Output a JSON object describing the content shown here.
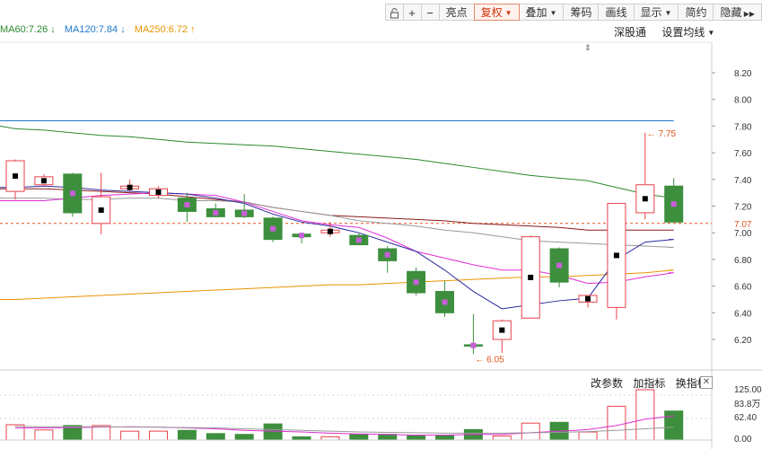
{
  "toolbar": {
    "lock_icon": "lock-icon",
    "zoom_in_icon": "plus-icon",
    "zoom_out_icon": "minus-icon",
    "highlight_label": "亮点",
    "restore_rights_label": "复权",
    "overlay_label": "叠加",
    "chips_label": "筹码",
    "draw_label": "画线",
    "display_label": "显示",
    "brief_label": "简约",
    "hide_label": "隐藏",
    "more_icon": "double-chevron-right-icon"
  },
  "legend": {
    "ma60": "MA60:7.26",
    "ma120": "MA120:7.84",
    "ma250": "MA250:6.72",
    "ma60_arrow": "↓",
    "ma120_arrow": "↓",
    "ma250_arrow": "↑",
    "colors": {
      "ma60": "#2c8a2c",
      "ma120": "#1f77c9",
      "ma250": "#e89400"
    }
  },
  "top_right": {
    "connect_label": "深股通",
    "settings_label": "设置均线"
  },
  "price_axis": {
    "ticks": [
      "8.20",
      "8.00",
      "7.80",
      "7.60",
      "7.40",
      "7.20",
      "7.00",
      "6.80",
      "6.60",
      "6.40",
      "6.20"
    ],
    "current_price": "7.07",
    "current_color": "#e3531b"
  },
  "annotations": {
    "high_label": "7.75",
    "low_label": "6.05",
    "label_color": "#e3531b"
  },
  "volume_panel": {
    "change_params_label": "改参数",
    "add_indicator_label": "加指标",
    "switch_indicator_label": "换指标",
    "close_icon": "close-icon",
    "axis_ticks": [
      "125.00",
      "62.40",
      "0.00"
    ],
    "max_label": "83.8万"
  },
  "chart_data": {
    "type": "candlestick",
    "ylim": [
      6.05,
      8.28
    ],
    "colors": {
      "up": "#e8414b",
      "down": "#3d8f3d"
    },
    "candles": [
      {
        "o": 7.31,
        "c": 7.54,
        "h": 7.55,
        "l": 7.25,
        "vol": 38
      },
      {
        "o": 7.36,
        "c": 7.42,
        "h": 7.44,
        "l": 7.35,
        "vol": 25
      },
      {
        "o": 7.44,
        "c": 7.15,
        "h": 7.45,
        "l": 7.12,
        "vol": 36
      },
      {
        "o": 7.07,
        "c": 7.27,
        "h": 7.45,
        "l": 6.99,
        "vol": 36
      },
      {
        "o": 7.33,
        "c": 7.35,
        "h": 7.4,
        "l": 7.31,
        "vol": 22
      },
      {
        "o": 7.28,
        "c": 7.33,
        "h": 7.35,
        "l": 7.26,
        "vol": 22
      },
      {
        "o": 7.26,
        "c": 7.16,
        "h": 7.3,
        "l": 7.08,
        "vol": 24
      },
      {
        "o": 7.18,
        "c": 7.12,
        "h": 7.22,
        "l": 7.12,
        "vol": 16
      },
      {
        "o": 7.17,
        "c": 7.12,
        "h": 7.29,
        "l": 7.11,
        "vol": 14
      },
      {
        "o": 7.11,
        "c": 6.95,
        "h": 7.12,
        "l": 6.93,
        "vol": 40
      },
      {
        "o": 6.99,
        "c": 6.97,
        "h": 7.0,
        "l": 6.92,
        "vol": 8
      },
      {
        "o": 7.0,
        "c": 7.02,
        "h": 7.08,
        "l": 6.97,
        "vol": 8
      },
      {
        "o": 6.98,
        "c": 6.91,
        "h": 7.0,
        "l": 6.91,
        "vol": 14
      },
      {
        "o": 6.88,
        "c": 6.79,
        "h": 6.9,
        "l": 6.7,
        "vol": 14
      },
      {
        "o": 6.71,
        "c": 6.55,
        "h": 6.74,
        "l": 6.53,
        "vol": 12
      },
      {
        "o": 6.56,
        "c": 6.4,
        "h": 6.64,
        "l": 6.37,
        "vol": 12
      },
      {
        "o": 6.16,
        "c": 6.15,
        "h": 6.39,
        "l": 6.09,
        "vol": 26
      },
      {
        "o": 6.2,
        "c": 6.34,
        "h": 6.35,
        "l": 6.1,
        "vol": 10
      },
      {
        "o": 6.36,
        "c": 6.97,
        "h": 6.98,
        "l": 6.36,
        "vol": 42
      },
      {
        "o": 6.88,
        "c": 6.63,
        "h": 6.89,
        "l": 6.59,
        "vol": 44
      },
      {
        "o": 6.48,
        "c": 6.53,
        "h": 6.53,
        "l": 6.44,
        "vol": 20
      },
      {
        "o": 6.44,
        "c": 7.22,
        "h": 7.22,
        "l": 6.35,
        "vol": 84
      },
      {
        "o": 7.15,
        "c": 7.36,
        "h": 7.75,
        "l": 7.1,
        "vol": 125
      },
      {
        "o": 7.35,
        "c": 7.08,
        "h": 7.41,
        "l": 7.08,
        "vol": 72
      }
    ],
    "x_start": 17,
    "x_step": 31.9,
    "series": [
      {
        "name": "MA120",
        "color": "#1f77c9",
        "values": [
          7.84,
          7.84,
          7.84,
          7.84,
          7.84,
          7.84,
          7.84,
          7.84,
          7.84,
          7.84,
          7.84,
          7.84,
          7.84,
          7.84,
          7.84,
          7.84,
          7.84,
          7.84,
          7.84,
          7.84,
          7.84,
          7.84,
          7.84,
          7.84
        ]
      },
      {
        "name": "MA60",
        "color": "#2c8a2c",
        "values": [
          7.78,
          7.77,
          7.75,
          7.73,
          7.72,
          7.7,
          7.68,
          7.67,
          7.66,
          7.65,
          7.63,
          7.61,
          7.59,
          7.57,
          7.55,
          7.52,
          7.49,
          7.46,
          7.43,
          7.41,
          7.39,
          7.34,
          7.29,
          7.26
        ]
      },
      {
        "name": "MA250",
        "color": "#e89400",
        "values": [
          6.5,
          6.51,
          6.52,
          6.53,
          6.54,
          6.55,
          6.56,
          6.57,
          6.58,
          6.59,
          6.6,
          6.61,
          6.61,
          6.62,
          6.63,
          6.64,
          6.65,
          6.66,
          6.67,
          6.67,
          6.68,
          6.69,
          6.7,
          6.72
        ]
      },
      {
        "name": "",
        "color": "#8b1a1a",
        "values": [
          7.33,
          7.33,
          7.32,
          7.31,
          7.3,
          7.29,
          7.27,
          7.25,
          7.23,
          7.19,
          7.16,
          7.13,
          7.12,
          7.11,
          7.1,
          7.09,
          7.07,
          7.06,
          7.05,
          7.04,
          7.02,
          7.02,
          7.02,
          7.02
        ]
      },
      {
        "name": "",
        "color": "#999999",
        "values": [
          7.26,
          7.26,
          7.25,
          7.25,
          7.26,
          7.26,
          7.24,
          7.24,
          7.23,
          7.19,
          7.16,
          7.13,
          7.09,
          7.07,
          7.05,
          7.02,
          7.0,
          6.97,
          6.94,
          6.93,
          6.92,
          6.91,
          6.9,
          6.89
        ]
      },
      {
        "name": "",
        "color": "#e02fd6",
        "values": [
          7.24,
          7.24,
          7.26,
          7.28,
          7.29,
          7.3,
          7.29,
          7.28,
          7.23,
          7.16,
          7.09,
          7.06,
          7.04,
          6.96,
          6.86,
          6.81,
          6.76,
          6.72,
          6.72,
          6.68,
          6.62,
          6.63,
          6.67,
          6.7
        ]
      },
      {
        "name": "",
        "color": "#2b2ba0",
        "values": [
          7.34,
          7.35,
          7.34,
          7.32,
          7.31,
          7.3,
          7.29,
          7.26,
          7.22,
          7.14,
          7.08,
          7.05,
          7.0,
          6.93,
          6.86,
          6.72,
          6.56,
          6.43,
          6.46,
          6.49,
          6.51,
          6.8,
          6.93,
          6.95
        ]
      }
    ]
  }
}
